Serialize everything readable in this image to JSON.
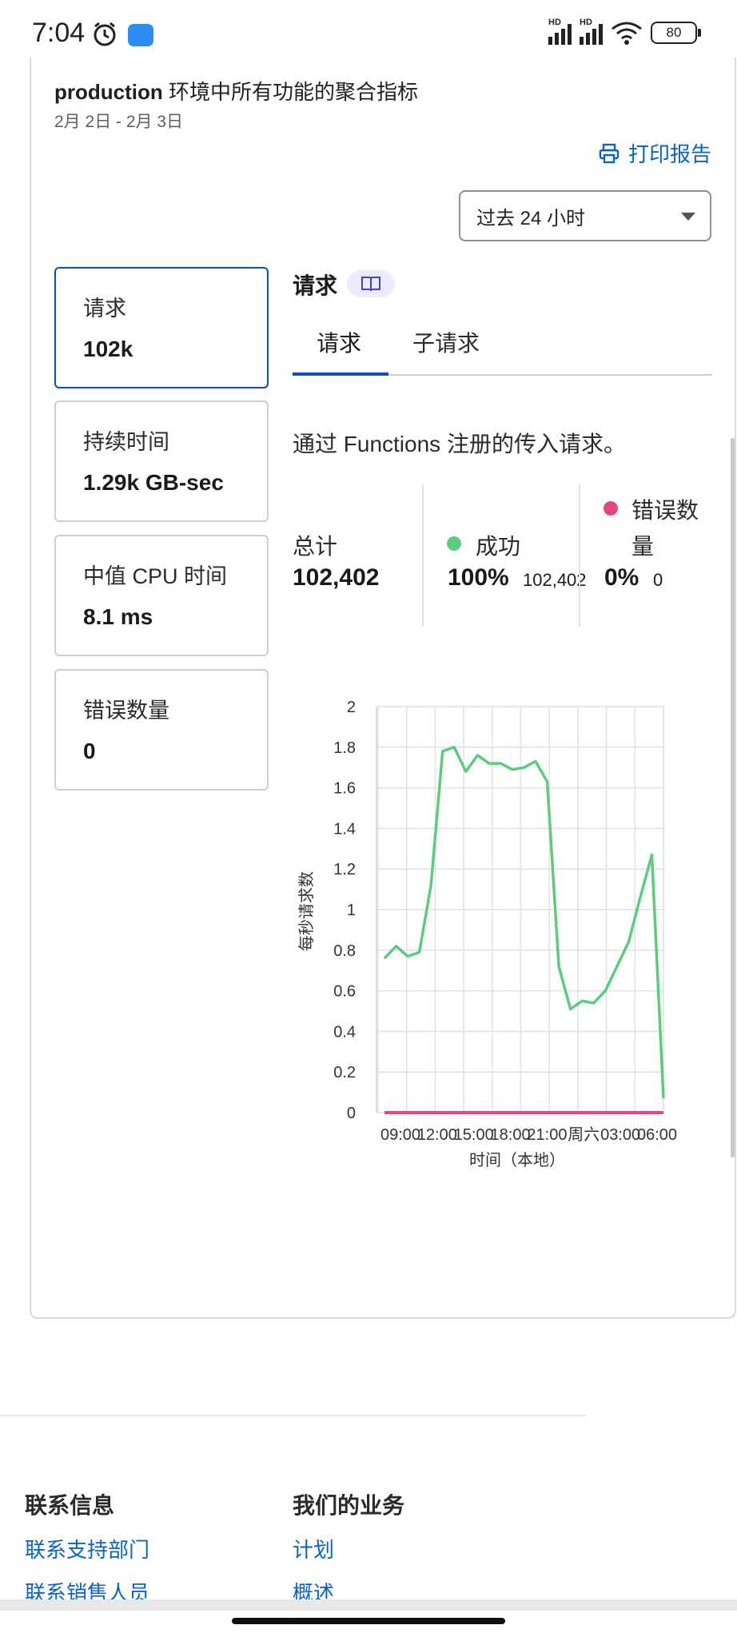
{
  "status_bar": {
    "time": "7:04",
    "battery": "80"
  },
  "header": {
    "env_name": "production",
    "subtitle_rest": " 环境中所有功能的聚合指标",
    "date_range": "2月 2日 - 2月 3日",
    "print_label": "打印报告",
    "time_range_selected": "过去 24 小时"
  },
  "metrics": [
    {
      "label": "请求",
      "value": "102k",
      "active": true
    },
    {
      "label": "持续时间",
      "value": "1.29k GB-sec",
      "active": false
    },
    {
      "label": "中值 CPU 时间",
      "value": "8.1 ms",
      "active": false
    },
    {
      "label": "错误数量",
      "value": "0",
      "active": false
    }
  ],
  "panel": {
    "title": "请求",
    "tabs": [
      {
        "label": "请求"
      },
      {
        "label": "子请求"
      }
    ],
    "description": "通过 Functions 注册的传入请求。",
    "stats": {
      "total_label": "总计",
      "total_value": "102,402",
      "success_label": "成功",
      "success_pct": "100%",
      "success_count": "102,402",
      "error_label_1": "错误数",
      "error_label_2": "量",
      "error_pct": "0%",
      "error_count": "0"
    },
    "colors": {
      "success": "#5ccc7e",
      "error": "#e5497b",
      "accent": "#0b4fb3",
      "link": "#0b63c8"
    }
  },
  "chart_data": {
    "type": "line",
    "xlabel": "时间（本地）",
    "ylabel": "每秒请求数",
    "ylim": [
      0,
      2
    ],
    "yticks": [
      "0",
      "0.2",
      "0.4",
      "0.6",
      "0.8",
      "1",
      "1.2",
      "1.4",
      "1.6",
      "1.8",
      "2"
    ],
    "xticks": [
      "09:00",
      "12:00",
      "15:00",
      "18:00",
      "21:00",
      "周六",
      "03:00",
      "06:00"
    ],
    "grid": true,
    "series": [
      {
        "color": "#5ccc7e",
        "values": [
          0.76,
          0.82,
          0.77,
          0.79,
          1.12,
          1.78,
          1.8,
          1.68,
          1.76,
          1.72,
          1.72,
          1.69,
          1.7,
          1.73,
          1.63,
          0.72,
          0.51,
          0.55,
          0.54,
          0.6,
          0.72,
          0.84,
          1.06,
          1.27,
          0.07
        ]
      },
      {
        "color": "#e5497b",
        "values": [
          0,
          0,
          0,
          0,
          0,
          0,
          0,
          0,
          0,
          0,
          0,
          0,
          0,
          0,
          0,
          0,
          0,
          0,
          0,
          0,
          0,
          0,
          0,
          0,
          0
        ]
      }
    ]
  },
  "footer": {
    "col1": {
      "heading": "联系信息",
      "links": [
        "联系支持部门",
        "联系销售人员"
      ]
    },
    "col2": {
      "heading": "我们的业务",
      "links": [
        "计划",
        "概述"
      ]
    }
  }
}
